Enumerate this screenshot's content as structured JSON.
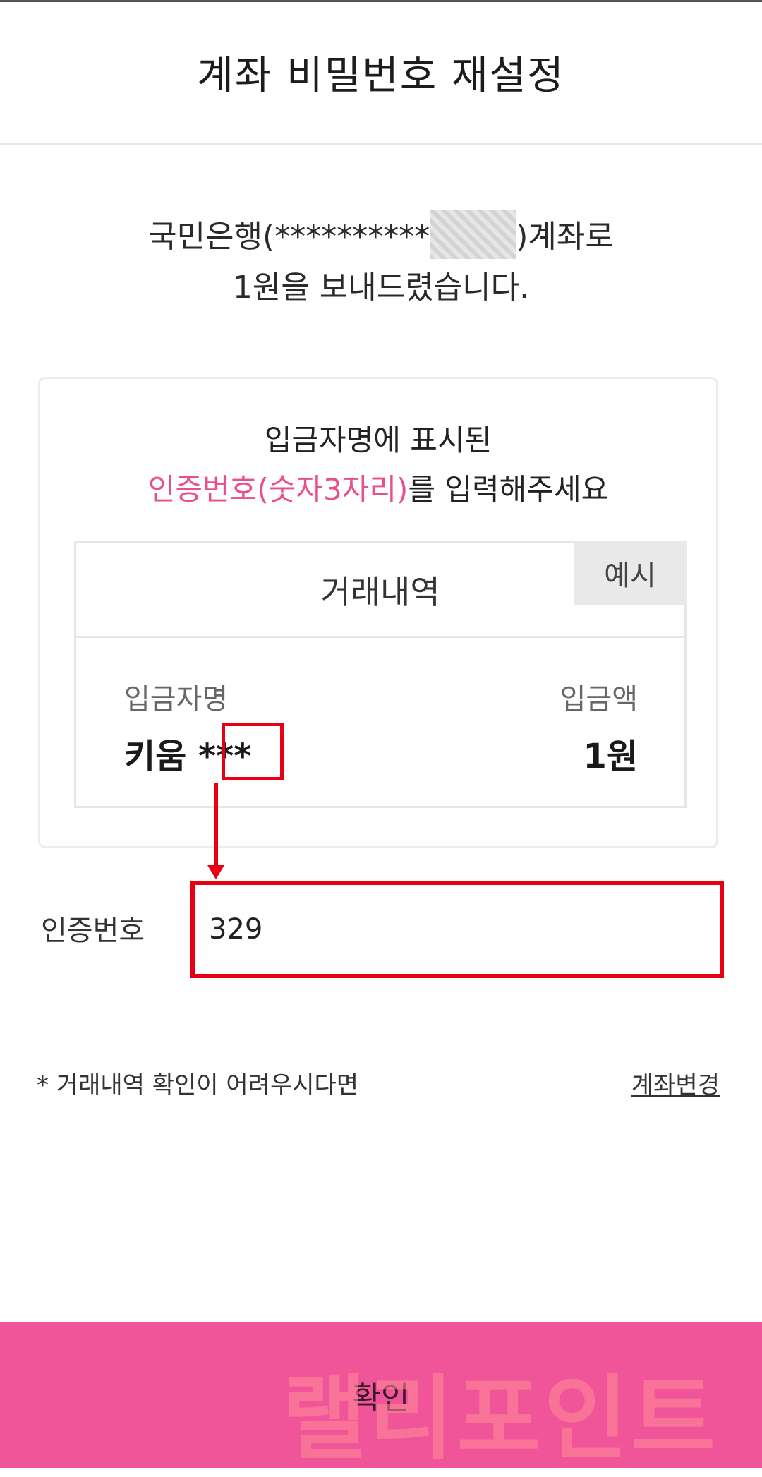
{
  "header": {
    "title": "계좌 비밀번호 재설정"
  },
  "message": {
    "line1_prefix": "국민은행(**********",
    "line1_suffix": ")계좌로",
    "line2": "1원을 보내드렸습니다."
  },
  "card": {
    "instruction_line1": "입금자명에 표시된",
    "instruction_highlight": "인증번호(숫자3자리)",
    "instruction_rest": "를 입력해주세요",
    "example": {
      "title": "거래내역",
      "badge": "예시",
      "depositor_label": "입금자명",
      "depositor_name": "키움",
      "depositor_code": "***",
      "amount_label": "입금액",
      "amount_value": "1원"
    }
  },
  "form": {
    "code_label": "인증번호",
    "code_value": "329"
  },
  "footer": {
    "note": "* 거래내역 확인이 어려우시다면",
    "change_link": "계좌변경",
    "confirm_label": "확인",
    "watermark": "랠리포인트"
  },
  "colors": {
    "accent_pink": "#ea4f8d",
    "button_pink": "#f0559a",
    "highlight_red": "#e60012"
  }
}
